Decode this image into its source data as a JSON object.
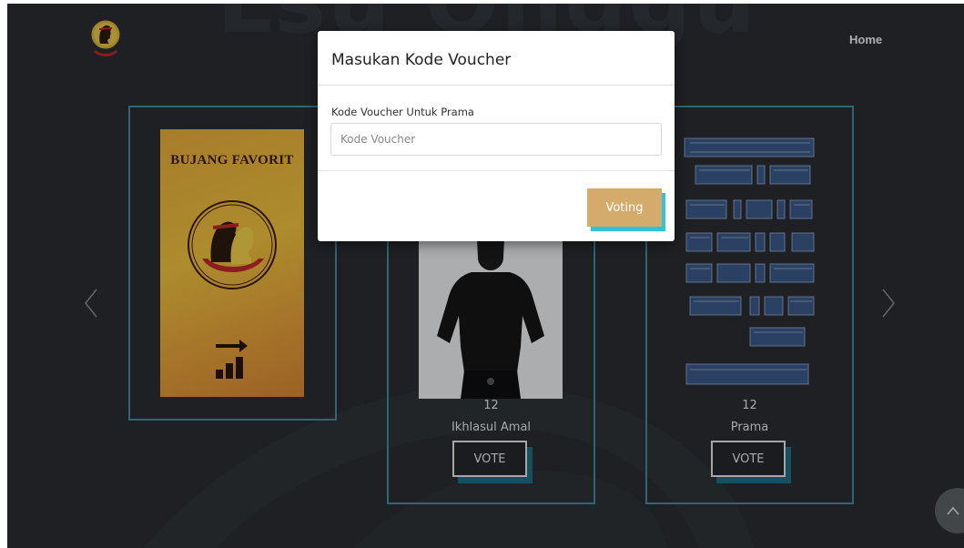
{
  "brand": {
    "logo_icon": "ebony-emblem-icon",
    "background_word": "Lsu Onggu"
  },
  "nav": {
    "home_label": "Home"
  },
  "colors": {
    "page_bg": "#2a2d31",
    "card_border": "#3d8ea6",
    "voting_button": "#d4ab6a",
    "voting_shadow": "#2ec3d6",
    "vote_shadow": "#1f6f86"
  },
  "candidates": [
    {
      "poster_title": "BUJANG FAVORIT"
    },
    {
      "count": "12",
      "name": "Ikhlasul Amal",
      "vote_label": "VOTE"
    },
    {
      "count": "12",
      "name": "Prama",
      "vote_label": "VOTE"
    }
  ],
  "carousel": {
    "prev_icon": "chevron-left-icon",
    "next_icon": "chevron-right-icon"
  },
  "scroll_top_icon": "chevron-up-icon",
  "modal": {
    "title": "Masukan Kode Voucher",
    "field_label": "Kode Voucher Untuk Prama",
    "placeholder": "Kode Voucher",
    "value": "",
    "submit_label": "Voting"
  }
}
